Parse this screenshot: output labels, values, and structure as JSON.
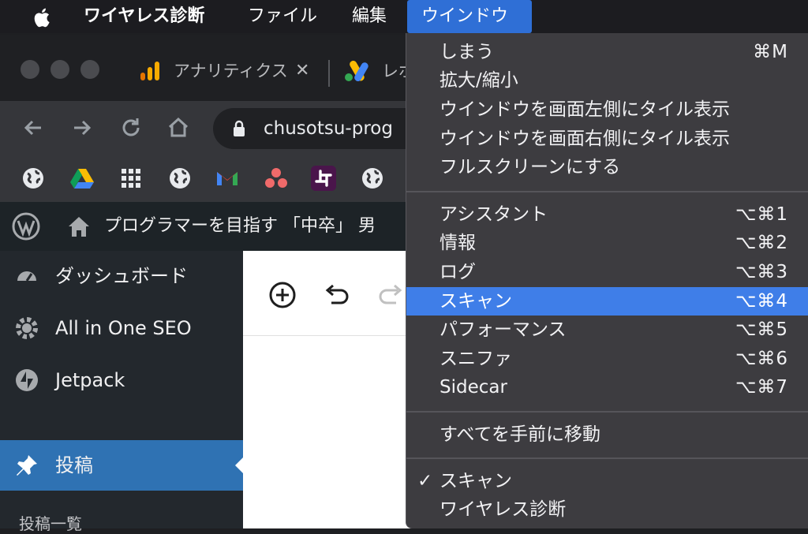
{
  "menubar": {
    "app": "ワイヤレス診断",
    "file": "ファイル",
    "edit": "編集",
    "window": "ウインドウ"
  },
  "browser": {
    "tabs": [
      {
        "label": "アナリティクス"
      },
      {
        "label": "レポ"
      }
    ],
    "url": "chusotsu-prog"
  },
  "wordpress": {
    "site_title": "プログラマーを目指す 「中卒」 男",
    "sidebar": [
      {
        "label": "ダッシュボード"
      },
      {
        "label": "All in One SEO"
      },
      {
        "label": "Jetpack"
      },
      {
        "label": "投稿"
      }
    ],
    "sidebar_sub": "投稿一覧"
  },
  "menu": {
    "items_a": [
      {
        "label": "しまう",
        "shortcut": "⌘M"
      },
      {
        "label": "拡大/縮小",
        "shortcut": ""
      },
      {
        "label": "ウインドウを画面左側にタイル表示",
        "shortcut": ""
      },
      {
        "label": "ウインドウを画面右側にタイル表示",
        "shortcut": ""
      },
      {
        "label": "フルスクリーンにする",
        "shortcut": ""
      }
    ],
    "items_b": [
      {
        "label": "アシスタント",
        "shortcut": "⌥⌘1"
      },
      {
        "label": "情報",
        "shortcut": "⌥⌘2"
      },
      {
        "label": "ログ",
        "shortcut": "⌥⌘3"
      },
      {
        "label": "スキャン",
        "shortcut": "⌥⌘4",
        "highlighted": true
      },
      {
        "label": "パフォーマンス",
        "shortcut": "⌥⌘5"
      },
      {
        "label": "スニファ",
        "shortcut": "⌥⌘6"
      },
      {
        "label": "Sidecar",
        "shortcut": "⌥⌘7"
      }
    ],
    "items_c": [
      {
        "label": "すべてを手前に移動"
      }
    ],
    "items_d": [
      {
        "label": "スキャン",
        "checked": "✓"
      },
      {
        "label": "ワイヤレス診断",
        "checked": ""
      }
    ]
  },
  "colors": {
    "menu_highlight": "#3f7ee8",
    "menubar_active": "#2f6fd6",
    "wp_active": "#2f72b3"
  }
}
